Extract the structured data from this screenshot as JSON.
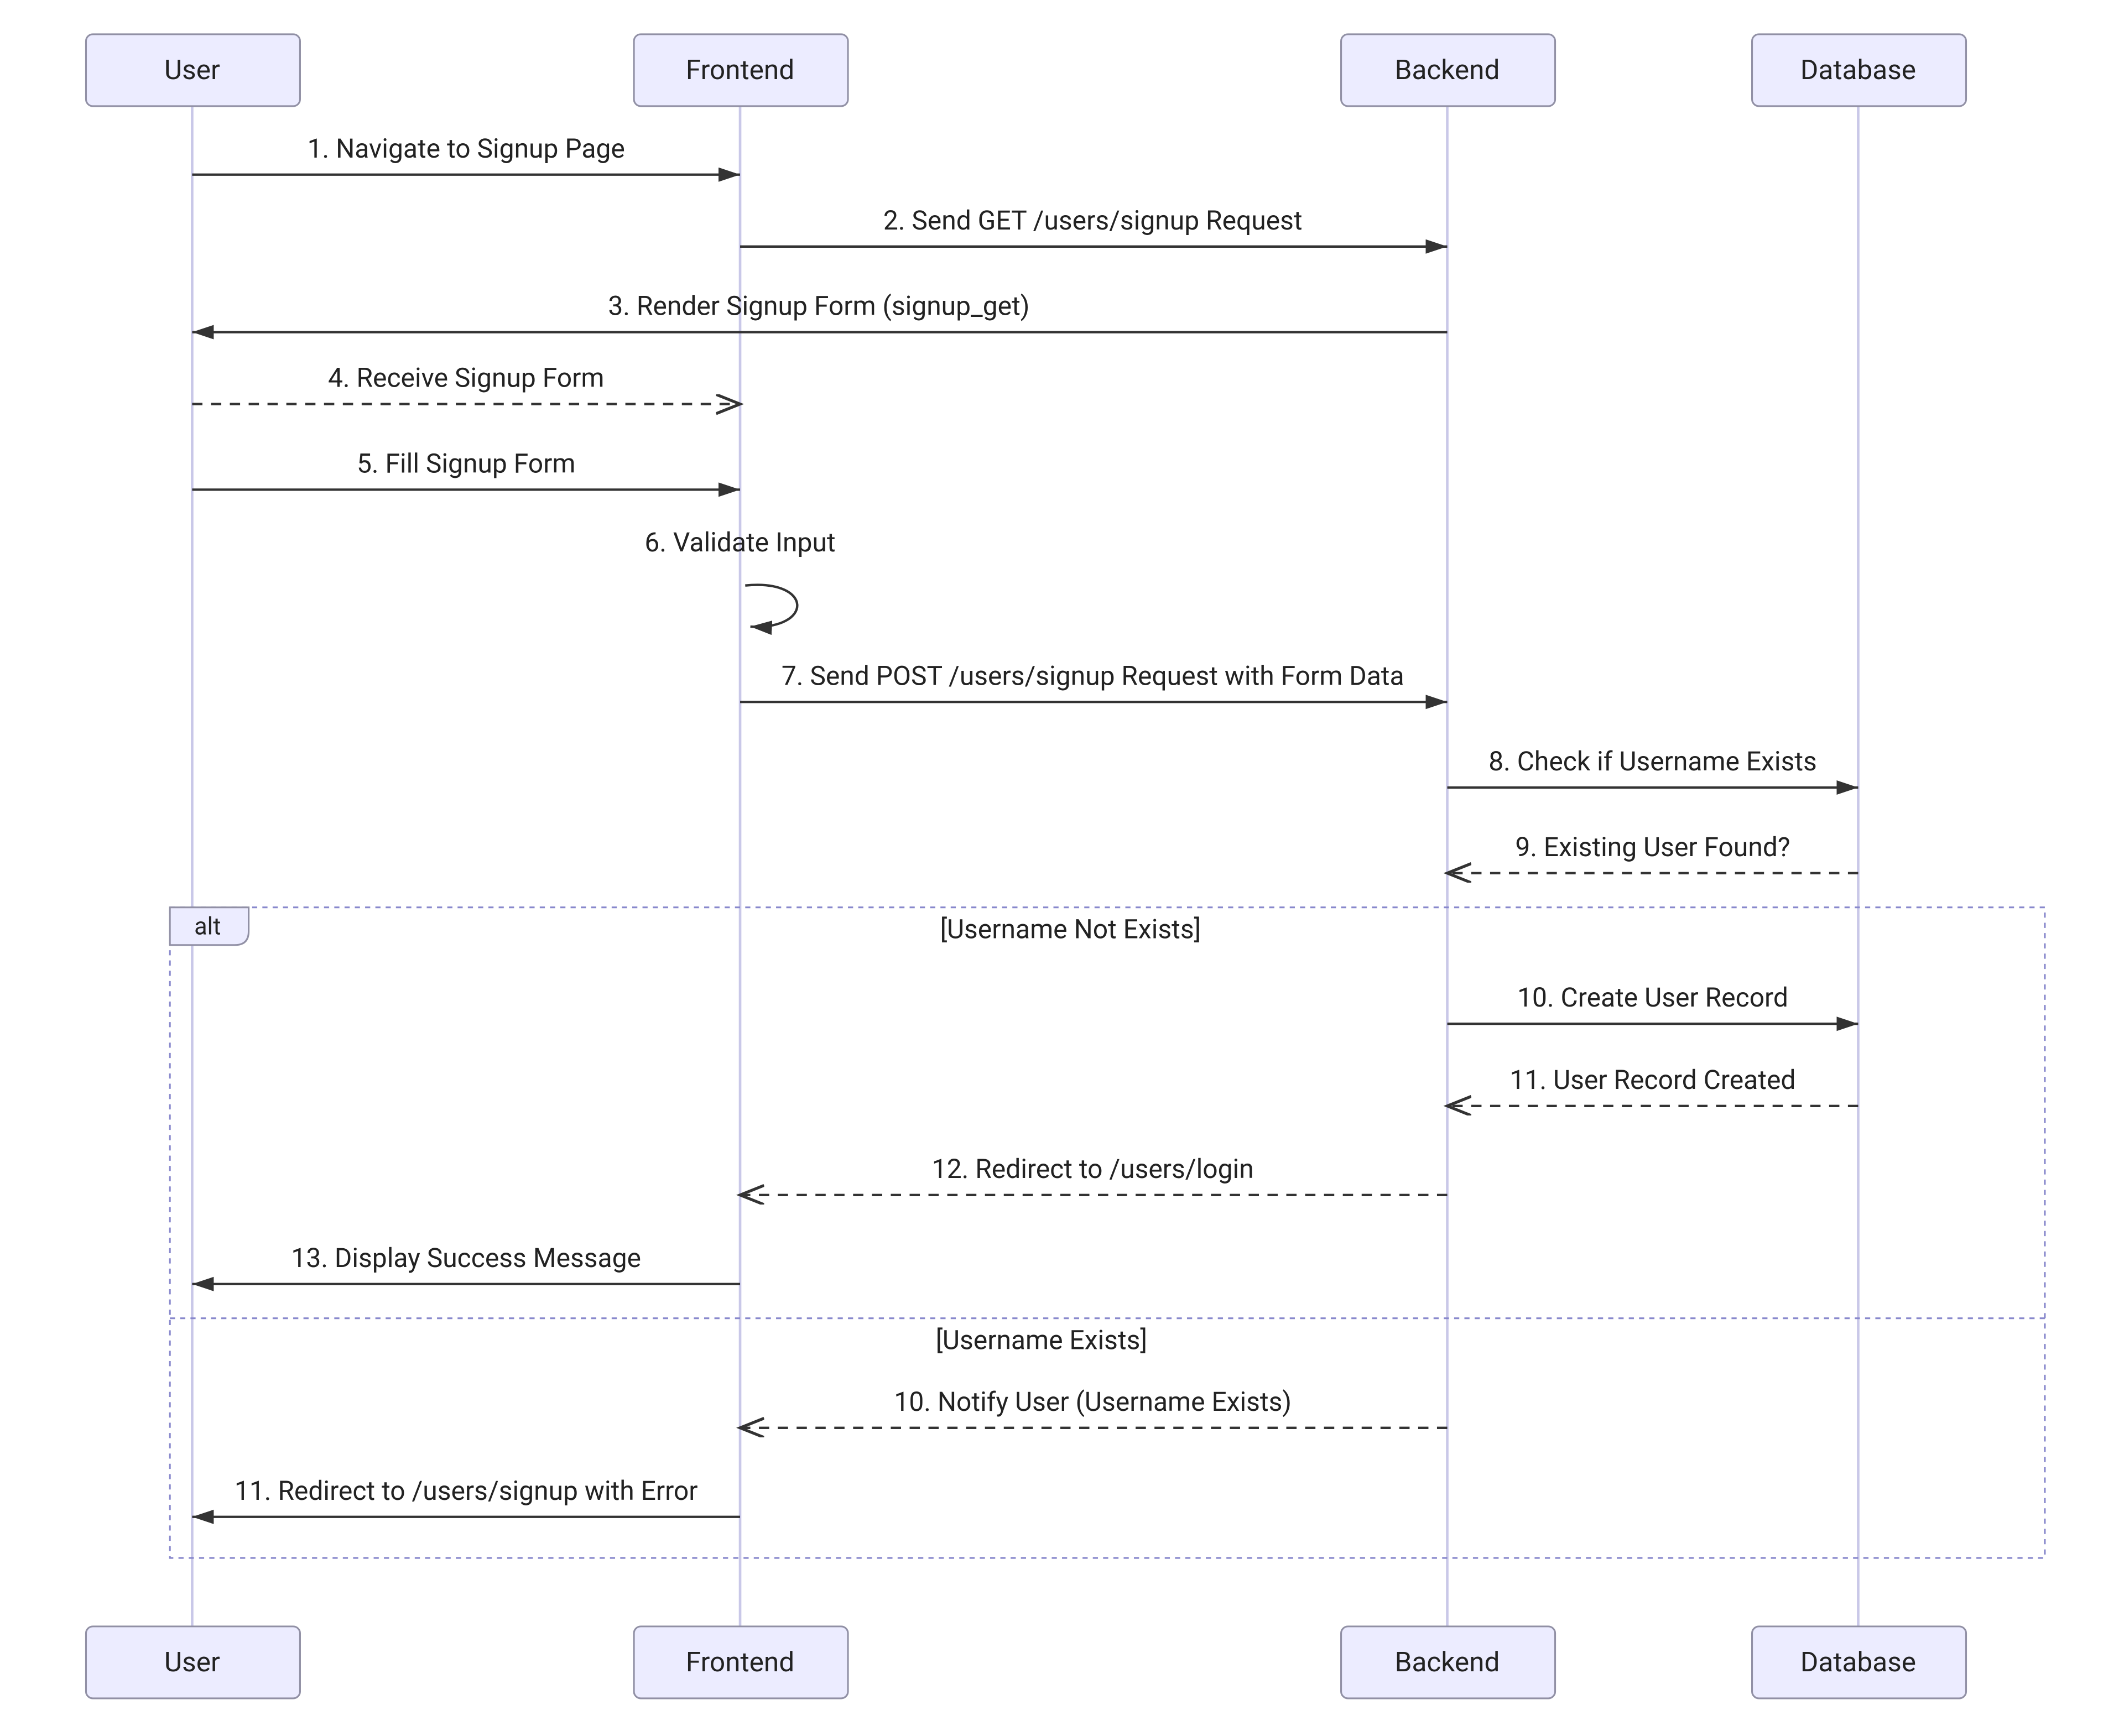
{
  "actors": {
    "user": "User",
    "frontend": "Frontend",
    "backend": "Backend",
    "database": "Database"
  },
  "messages": {
    "m1": "1. Navigate to Signup Page",
    "m2": "2. Send GET /users/signup Request",
    "m3": "3. Render Signup Form (signup_get)",
    "m4": "4. Receive Signup Form",
    "m5": "5. Fill Signup Form",
    "m6": "6. Validate Input",
    "m7": "7. Send POST /users/signup Request with Form Data",
    "m8": "8. Check if Username Exists",
    "m9": "9. Existing User Found?",
    "m10a": "10. Create User Record",
    "m11a": "11. User Record Created",
    "m12a": "12. Redirect to /users/login",
    "m13a": "13. Display Success Message",
    "m10b": "10. Notify User (Username Exists)",
    "m11b": "11. Redirect to /users/signup with Error"
  },
  "alt": {
    "label": "alt",
    "guard1": "[Username Not Exists]",
    "guard2": "[Username Exists]"
  }
}
